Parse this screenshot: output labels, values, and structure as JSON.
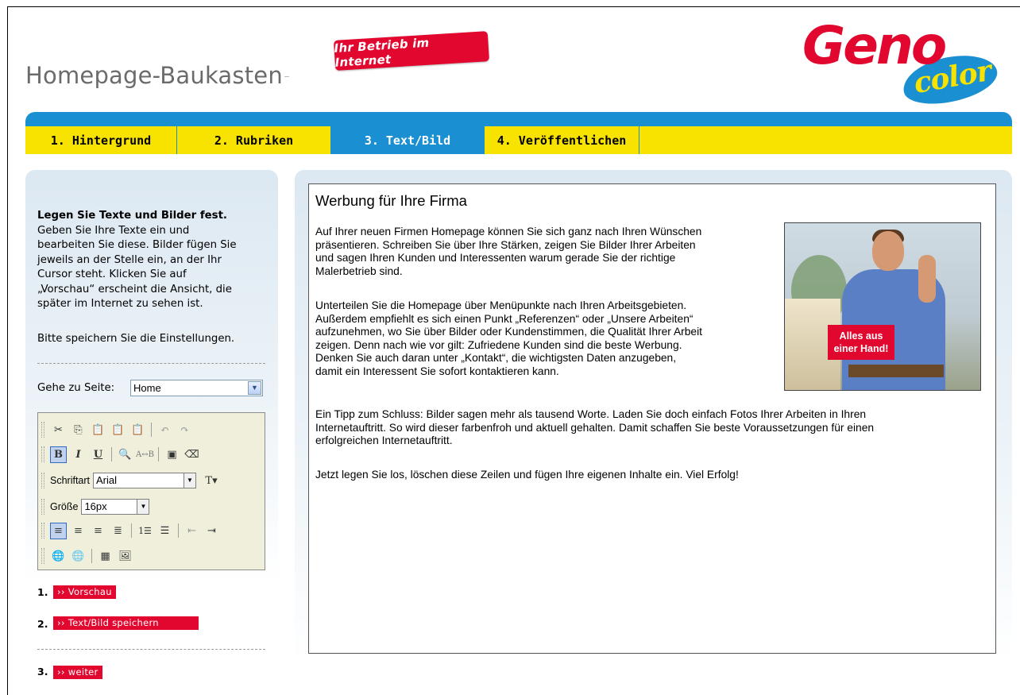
{
  "app": {
    "title": "Homepage-Baukasten",
    "badge": "Ihr Betrieb im Internet",
    "logo_word": "Geno",
    "logo_subword": "color"
  },
  "nav": {
    "tabs": [
      {
        "label": "1. Hintergrund",
        "active": false
      },
      {
        "label": "2. Rubriken",
        "active": false
      },
      {
        "label": "3. Text/Bild",
        "active": true
      },
      {
        "label": "4. Veröffentlichen",
        "active": false
      }
    ]
  },
  "sidebar": {
    "heading": "Legen Sie Texte und Bilder fest.",
    "lines": [
      "Geben Sie Ihre Texte ein und",
      "bearbeiten Sie diese. Bilder fügen Sie",
      "jeweils an der Stelle ein, an der Ihr",
      "Cursor steht. Klicken Sie auf",
      "„Vorschau“ erscheint die Ansicht, die",
      "später im Internet zu sehen ist."
    ],
    "save_note": "Bitte speichern Sie die Einstellungen.",
    "goto_label": "Gehe zu Seite:",
    "goto_value": "Home"
  },
  "toolbar": {
    "font_label": "Schriftart",
    "font_value": "Arial",
    "size_label": "Größe",
    "size_value": "16px"
  },
  "steps": [
    {
      "number": "1.",
      "label": "›› Vorschau"
    },
    {
      "number": "2.",
      "label": "›› Text/Bild speichern"
    },
    {
      "number": "3.",
      "label": "›› weiter"
    }
  ],
  "editor": {
    "heading": "Werbung für Ihre Firma",
    "p1": [
      "Auf Ihrer neuen Firmen Homepage können Sie sich ganz nach Ihren Wünschen",
      "präsentieren. Schreiben Sie über Ihre Stärken, zeigen Sie Bilder Ihrer Arbeiten",
      "und sagen Ihren Kunden und Interessenten warum gerade Sie der richtige",
      "Malerbetrieb sind."
    ],
    "p2": [
      "Unterteilen Sie die Homepage über Menüpunkte nach Ihren Arbeitsgebieten.",
      "Außerdem empfiehlt es sich einen Punkt „Referenzen“ oder „Unsere Arbeiten“",
      "aufzunehmen, wo Sie über Bilder oder Kundenstimmen, die Qualität Ihrer Arbeit",
      "zeigen. Denn nach wie vor gilt: Zufriedene Kunden sind die beste Werbung.",
      "Denken Sie auch daran unter „Kontakt“, die wichtigsten Daten anzugeben,",
      "damit ein Interessent Sie sofort kontaktieren kann."
    ],
    "p3": [
      "Ein Tipp zum Schluss: Bilder sagen mehr als tausend Worte. Laden Sie doch einfach Fotos Ihrer Arbeiten in Ihren",
      "Internetauftritt. So wird dieser farbenfroh und aktuell gehalten. Damit schaffen Sie beste Voraussetzungen für einen",
      "erfolgreichen Internetauftritt."
    ],
    "p4": "Jetzt legen Sie los, löschen diese Zeilen und fügen Ihre eigenen Inhalte ein. Viel Erfolg!",
    "photo_tag_line1": "Alles aus",
    "photo_tag_line2": "einer Hand!"
  },
  "colors": {
    "brand_red": "#e2072e",
    "brand_blue": "#1a8fd2",
    "brand_yellow": "#f7e200"
  }
}
